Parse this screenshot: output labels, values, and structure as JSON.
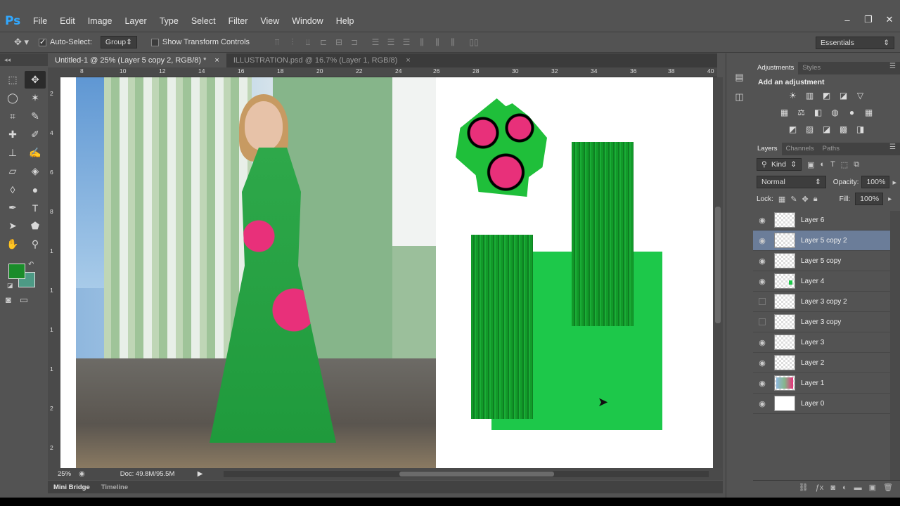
{
  "app": {
    "logo": "Ps"
  },
  "menu": [
    "File",
    "Edit",
    "Image",
    "Layer",
    "Type",
    "Select",
    "Filter",
    "View",
    "Window",
    "Help"
  ],
  "window_controls": [
    "–",
    "❐",
    "✕"
  ],
  "options": {
    "auto_select_label": "Auto-Select:",
    "auto_select_checked": true,
    "auto_select_target": "Group",
    "transform_label": "Show Transform Controls",
    "transform_checked": false,
    "workspace": "Essentials"
  },
  "tabs": [
    {
      "label": "Untitled-1 @ 25% (Layer 5 copy 2, RGB/8) *",
      "close": "×",
      "active": true
    },
    {
      "label": "ILLUSTRATION.psd @ 16.7% (Layer 1, RGB/8)",
      "close": "×",
      "active": false
    }
  ],
  "ruler": {
    "top": [
      "8",
      "10",
      "12",
      "14",
      "16",
      "18",
      "20",
      "22",
      "24",
      "26",
      "28",
      "30",
      "32",
      "34",
      "36",
      "38",
      "40"
    ],
    "left": [
      "2",
      "4",
      "6",
      "8",
      "1",
      "1",
      "1",
      "1",
      "2",
      "2"
    ]
  },
  "status": {
    "zoom": "25%",
    "doc": "Doc: 49.8M/95.5M"
  },
  "bottom_tabs": [
    "Mini Bridge",
    "Timeline"
  ],
  "adjustments": {
    "tabs": [
      "Adjustments",
      "Styles"
    ],
    "title": "Add an adjustment",
    "rows": [
      [
        "☀",
        "▥",
        "◩",
        "◪",
        "▽"
      ],
      [
        "▦",
        "⚖",
        "◧",
        "◍",
        "●",
        "▦"
      ],
      [
        "◩",
        "▨",
        "◪",
        "▩",
        "◨"
      ]
    ]
  },
  "layers_panel": {
    "tabs": [
      "Layers",
      "Channels",
      "Paths"
    ],
    "kind": "Kind",
    "blend_mode": "Normal",
    "opacity_label": "Opacity:",
    "opacity": "100%",
    "lock_label": "Lock:",
    "fill_label": "Fill:",
    "fill": "100%",
    "layers": [
      {
        "name": "Layer 6",
        "visible": true,
        "selected": false,
        "thumb": "transparent"
      },
      {
        "name": "Layer 5 copy 2",
        "visible": true,
        "selected": true,
        "thumb": "transparent"
      },
      {
        "name": "Layer 5 copy",
        "visible": true,
        "selected": false,
        "thumb": "transparent"
      },
      {
        "name": "Layer 4",
        "visible": true,
        "selected": false,
        "thumb": "dot"
      },
      {
        "name": "Layer 3 copy 2",
        "visible": false,
        "selected": false,
        "thumb": "transparent"
      },
      {
        "name": "Layer 3 copy",
        "visible": false,
        "selected": false,
        "thumb": "transparent"
      },
      {
        "name": "Layer 3",
        "visible": true,
        "selected": false,
        "thumb": "transparent"
      },
      {
        "name": "Layer 2",
        "visible": true,
        "selected": false,
        "thumb": "transparent"
      },
      {
        "name": "Layer 1",
        "visible": true,
        "selected": false,
        "thumb": "photo"
      },
      {
        "name": "Layer 0",
        "visible": true,
        "selected": false,
        "thumb": "white"
      }
    ]
  },
  "colors": {
    "foreground": "#1a8c2a",
    "background": "#4d9a85",
    "accent_green": "#1dc84a",
    "selection": "#6b7d99"
  }
}
